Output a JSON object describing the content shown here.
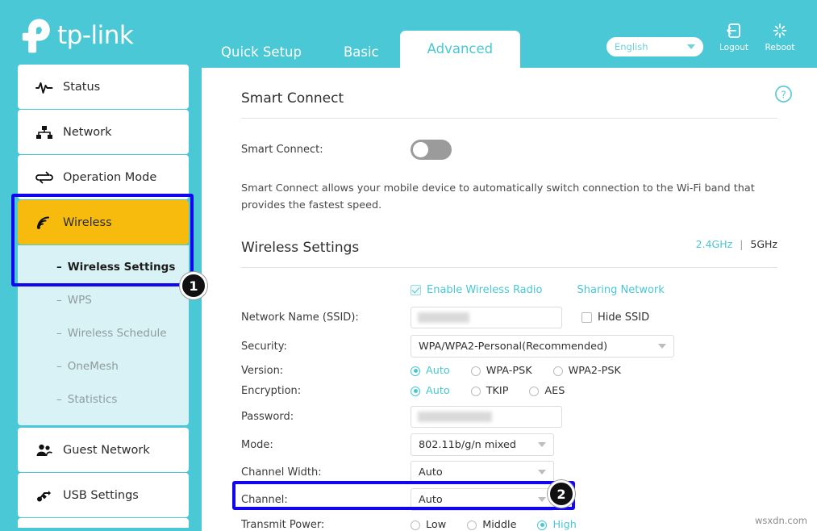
{
  "brand": {
    "name": "tp-link",
    "logo_icon": "tp-link-logo"
  },
  "header": {
    "tabs": [
      {
        "label": "Quick Setup",
        "active": false
      },
      {
        "label": "Basic",
        "active": false
      },
      {
        "label": "Advanced",
        "active": true
      }
    ],
    "language": {
      "value": "English",
      "caret_icon": "chevron-down-icon"
    },
    "logout": {
      "label": "Logout",
      "icon": "logout-icon"
    },
    "reboot": {
      "label": "Reboot",
      "icon": "reboot-icon"
    }
  },
  "sidebar": {
    "items": [
      {
        "label": "Status",
        "icon": "pulse-icon",
        "active": false
      },
      {
        "label": "Network",
        "icon": "network-tree-icon",
        "active": false
      },
      {
        "label": "Operation Mode",
        "icon": "exchange-arrows-icon",
        "active": false
      },
      {
        "label": "Wireless",
        "icon": "wifi-signal-icon",
        "active": true
      },
      {
        "label": "Guest Network",
        "icon": "users-icon",
        "active": false
      },
      {
        "label": "USB Settings",
        "icon": "usb-icon",
        "active": false
      }
    ],
    "wireless_submenu": [
      {
        "label": "Wireless Settings",
        "active": true
      },
      {
        "label": "WPS",
        "active": false
      },
      {
        "label": "Wireless Schedule",
        "active": false
      },
      {
        "label": "OneMesh",
        "active": false
      },
      {
        "label": "Statistics",
        "active": false
      }
    ]
  },
  "content": {
    "help_icon": "question-circle-icon",
    "smart_connect": {
      "title": "Smart Connect",
      "field_label": "Smart Connect:",
      "toggle_state": "off",
      "description": "Smart Connect allows your mobile device to automatically switch connection to the Wi-Fi band that provides the fastest speed."
    },
    "wireless_settings": {
      "title": "Wireless Settings",
      "bands": [
        {
          "label": "2.4GHz",
          "active": true
        },
        {
          "label": "5GHz",
          "active": false
        }
      ],
      "band_separator": "|",
      "enable_radio": {
        "label": "Enable Wireless Radio",
        "checked": true
      },
      "sharing_network": {
        "label": "Sharing Network"
      },
      "ssid": {
        "label": "Network Name (SSID):",
        "value": "",
        "redacted": true
      },
      "hide_ssid": {
        "label": "Hide SSID",
        "checked": false
      },
      "security": {
        "label": "Security:",
        "value": "WPA/WPA2-Personal(Recommended)",
        "caret_icon": "chevron-down-icon"
      },
      "version": {
        "label": "Version:",
        "options": [
          {
            "label": "Auto",
            "selected": true
          },
          {
            "label": "WPA-PSK",
            "selected": false
          },
          {
            "label": "WPA2-PSK",
            "selected": false
          }
        ]
      },
      "encryption": {
        "label": "Encryption:",
        "options": [
          {
            "label": "Auto",
            "selected": true
          },
          {
            "label": "TKIP",
            "selected": false
          },
          {
            "label": "AES",
            "selected": false
          }
        ]
      },
      "password": {
        "label": "Password:",
        "value": "",
        "redacted": true
      },
      "mode": {
        "label": "Mode:",
        "value": "802.11b/g/n mixed",
        "caret_icon": "chevron-down-icon"
      },
      "channel_width": {
        "label": "Channel Width:",
        "value": "Auto",
        "caret_icon": "chevron-down-icon"
      },
      "channel": {
        "label": "Channel:",
        "value": "Auto",
        "caret_icon": "chevron-down-icon"
      },
      "transmit_power": {
        "label": "Transmit Power:",
        "options": [
          {
            "label": "Low",
            "selected": false
          },
          {
            "label": "Middle",
            "selected": false
          },
          {
            "label": "High",
            "selected": true
          }
        ]
      }
    }
  },
  "annotations": [
    {
      "number": "1",
      "target": "wireless-sidebar-group"
    },
    {
      "number": "2",
      "target": "channel-row"
    }
  ],
  "watermark": "wsxdn.com",
  "colors": {
    "teal": "#4ac8d5",
    "teal_text": "#49c7d4",
    "amber": "#f6bb0c",
    "submenu_bg": "#d8f2f5",
    "annotation_blue": "#1205f2"
  }
}
